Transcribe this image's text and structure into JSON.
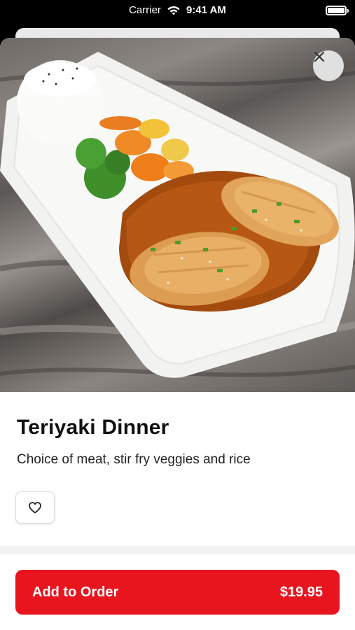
{
  "status_bar": {
    "carrier": "Carrier",
    "time": "9:41 AM"
  },
  "item": {
    "title": "Teriyaki Dinner",
    "description": "Choice of meat, stir fry veggies and rice",
    "image_alt": "teriyaki-dinner-photo"
  },
  "actions": {
    "add_to_order_label": "Add to Order",
    "price": "$19.95"
  },
  "colors": {
    "accent": "#e8141e"
  },
  "icons": {
    "close": "close-icon",
    "favorite": "heart-icon"
  }
}
